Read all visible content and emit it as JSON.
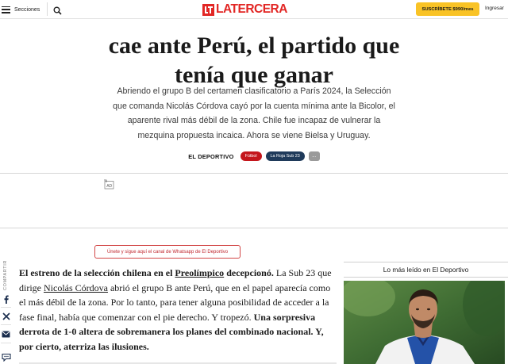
{
  "header": {
    "menu_label": "Secciones",
    "logo_text": "LATERCERA",
    "subscribe_label": "SUSCRÍBETE $990/mes",
    "login_label": "Ingresar"
  },
  "article": {
    "headline_lines": [
      "cae ante Perú, el partido que",
      "tenía que ganar"
    ],
    "summary": "Abriendo el grupo B del certamen clasificatorio a París 2024, la Selección que comanda Nicolás Córdova cayó por la cuenta mínima ante la Bicolor, el aparente rival más débil de la zona. Chile fue incapaz de vulnerar la mezquina propuesta incaica. Ahora se viene Bielsa y Uruguay.",
    "section": "EL DEPORTIVO",
    "tags": [
      "Fútbol",
      "La Roja Sub 23",
      "..."
    ],
    "whatsapp_banner": "Únete y sigue aquí el canal de Whatsapp de El Deportivo",
    "share_label": "COMPARTIR",
    "body": {
      "lead_bold": "El estreno de la selección chilena en el",
      "lead_link": "Preolímpico",
      "lead_bold_end": " decepcionó.",
      "text_1": " La Sub 23 que dirige ",
      "link_2": "Nicolás Córdova",
      "text_2": " abrió el grupo B ante Perú, que en el papel aparecía como el más débil de la zona. Por lo tanto, para tener alguna posibilidad de acceder a la fase final, había que comenzar con el pie derecho. Y tropezó. ",
      "bold_end": "Una sorpresiva derrota de 1-0 altera de sobremanera los planes del combinado nacional. Y, por cierto, aterriza las ilusiones."
    }
  },
  "sidebar": {
    "most_read_title": "Lo más leído en El Deportivo"
  },
  "colors": {
    "brand_red": "#e22624",
    "subscribe_yellow": "#f9c326",
    "tag_red": "#c4161c",
    "tag_navy": "#1f3a5a"
  },
  "icons": [
    "hamburger-icon",
    "search-icon",
    "ad-icon",
    "facebook-icon",
    "x-icon",
    "email-icon",
    "comments-icon"
  ]
}
